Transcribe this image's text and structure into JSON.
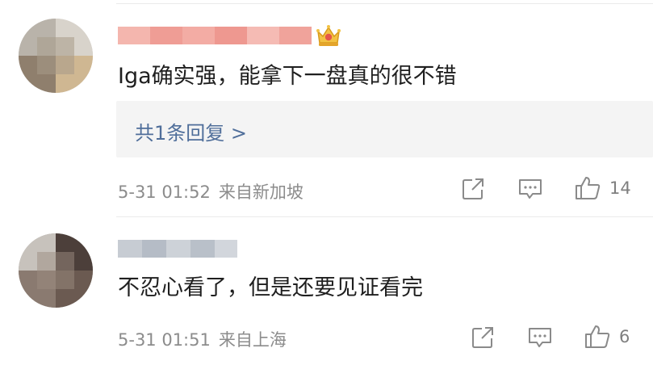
{
  "comments": [
    {
      "content": "Iga确实强，能拿下一盘真的很不错",
      "reply": "共1条回复 >",
      "date": "5-31 01:52",
      "source": "来自新加坡",
      "like_count": "14"
    },
    {
      "content": "不忍心看了，但是还要见证看完",
      "date": "5-31 01:51",
      "source": "来自上海",
      "like_count": "6"
    }
  ],
  "icons": {
    "share": "share-icon",
    "comment": "comment-icon",
    "like": "thumb-up-icon",
    "badge": "crown-icon"
  },
  "colors": {
    "link": "#4f6e9a",
    "meta": "#8c8c8c",
    "username_blur": "#f2a7a0"
  }
}
